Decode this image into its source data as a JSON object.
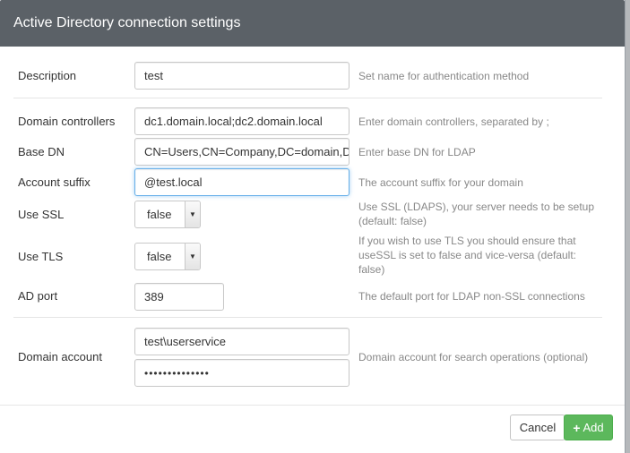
{
  "header": {
    "title": "Active Directory connection settings"
  },
  "fields": {
    "description": {
      "label": "Description",
      "value": "test",
      "help": "Set name for authentication method"
    },
    "domain_controllers": {
      "label": "Domain controllers",
      "value": "dc1.domain.local;dc2.domain.local",
      "help": "Enter domain controllers, separated by ;"
    },
    "base_dn": {
      "label": "Base DN",
      "value": "CN=Users,CN=Company,DC=domain,D",
      "help": "Enter base DN for LDAP"
    },
    "account_suffix": {
      "label": "Account suffix",
      "value": "@test.local",
      "help": "The account suffix for your domain"
    },
    "use_ssl": {
      "label": "Use SSL",
      "value": "false",
      "help": "Use SSL (LDAPS), your server needs to be setup (default: false)"
    },
    "use_tls": {
      "label": "Use TLS",
      "value": "false",
      "help": "If you wish to use TLS you should ensure that useSSL is set to false and vice-versa (default: false)"
    },
    "ad_port": {
      "label": "AD port",
      "value": "389",
      "help": "The default port for LDAP non-SSL connections"
    },
    "domain_account": {
      "label": "Domain account",
      "username": "test\\userservice",
      "password_mask": "••••••••••••••",
      "help": "Domain account for search operations (optional)"
    }
  },
  "footer": {
    "cancel_label": "Cancel",
    "add_label": "Add",
    "add_icon": "+"
  },
  "colors": {
    "header_bg": "#5b6167",
    "add_button": "#5cb85c",
    "focus_border": "#66afe9"
  }
}
